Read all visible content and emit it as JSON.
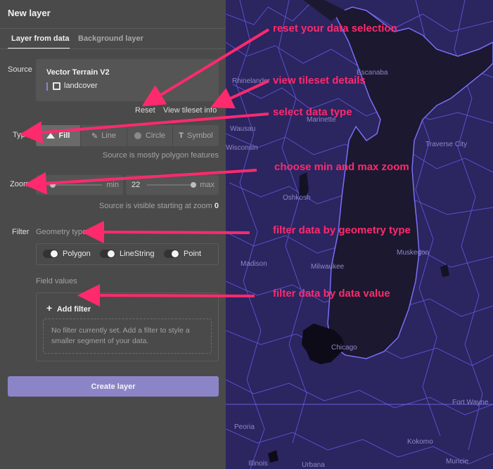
{
  "panel": {
    "title": "New layer",
    "tabs": [
      {
        "label": "Layer from data",
        "active": true
      },
      {
        "label": "Background layer",
        "active": false
      }
    ],
    "source": {
      "label": "Source",
      "tileset_name": "Vector Terrain V2",
      "layer_name": "landcover",
      "reset_label": "Reset",
      "info_label": "View tileset info"
    },
    "type": {
      "label": "Type",
      "options": [
        {
          "label": "Fill",
          "icon": "fill-icon",
          "active": true
        },
        {
          "label": "Line",
          "icon": "line-icon",
          "active": false
        },
        {
          "label": "Circle",
          "icon": "circle-icon",
          "active": false
        },
        {
          "label": "Symbol",
          "icon": "symbol-icon",
          "active": false
        }
      ],
      "hint": "Source is mostly polygon features"
    },
    "zoom": {
      "label": "Zoom",
      "min_label": "min",
      "max_value": "22",
      "max_label": "max",
      "hint": "Source is visible starting at zoom",
      "hint_value": "0"
    },
    "filter": {
      "label": "Filter",
      "geometry_label": "Geometry type",
      "geometry_options": [
        "Polygon",
        "LineString",
        "Point"
      ],
      "field_values_label": "Field values",
      "add_filter_label": "Add filter",
      "empty_text": "No filter currently set. Add a filter to style a smaller segment of your data."
    },
    "create_label": "Create layer"
  },
  "map": {
    "cities": [
      "Rhinelander",
      "Escanaba",
      "Marinette",
      "Wausau",
      "Wisconsin",
      "Traverse City",
      "Oshkosh",
      "Madison",
      "Milwaukee",
      "Muskegon",
      "Chicago",
      "Fort Wayne",
      "Peoria",
      "Kokomo",
      "Illinois",
      "Urbana",
      "Muncie"
    ]
  },
  "annotations": [
    "reset your data selection",
    "view tileset details",
    "select data type",
    "choose min and max zoom",
    "filter data by geometry type",
    "filter data by data value"
  ],
  "colors": {
    "panel_bg": "#4a4a4a",
    "map_bg": "#2b2560",
    "accent": "#8b85c8",
    "annotation": "#ff2a6d"
  }
}
